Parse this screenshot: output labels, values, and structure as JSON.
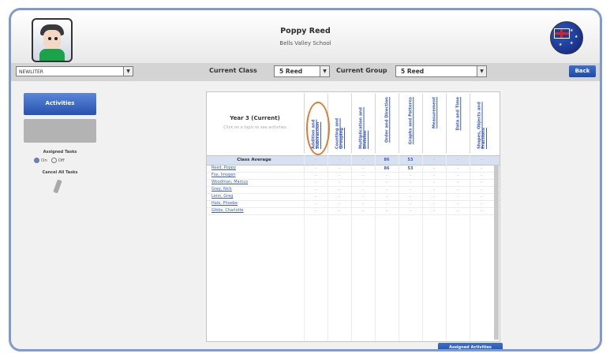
{
  "header": {
    "student_name": "Poppy Reed",
    "school_name": "Bells Valley School"
  },
  "toolbar": {
    "left_select_value": "NEWLITER",
    "current_class_label": "Current Class",
    "current_class_value": "5 Reed",
    "current_group_label": "Current Group",
    "current_group_value": "5 Reed",
    "back_label": "Back"
  },
  "sidebar": {
    "activities_label": "Activities",
    "assigned_tasks_label": "Assigned Tasks",
    "radio_on_label": "On",
    "radio_off_label": "Off",
    "cancel_all_label": "Cancel All Tasks"
  },
  "grid": {
    "year_title": "Year 3 (Current)",
    "year_subtitle": "Click on a topic to see activities",
    "columns": [
      "Addition and Subtraction",
      "Counting and Grouping",
      "Multiplication and Division",
      "Order and Direction",
      "Graphs and Patterns",
      "Measurement",
      "Data and Time",
      "Shapes, Objects and Fractions"
    ],
    "average_label": "Class Average",
    "average_values": [
      "-",
      "-",
      "-",
      "86",
      "53",
      "-",
      "-",
      "-"
    ],
    "students": [
      {
        "name": "Reed, Poppy",
        "values": [
          "-",
          "-",
          "-",
          "86",
          "53",
          "-",
          "-",
          "-"
        ]
      },
      {
        "name": "Fox, Imogen",
        "values": [
          "-",
          "-",
          "-",
          "-",
          "-",
          "-",
          "-",
          "-"
        ]
      },
      {
        "name": "Woodman, Marcus",
        "values": [
          "-",
          "-",
          "-",
          "-",
          "-",
          "-",
          "-",
          "-"
        ]
      },
      {
        "name": "Grey, Nick",
        "values": [
          "-",
          "-",
          "-",
          "-",
          "-",
          "-",
          "-",
          "-"
        ]
      },
      {
        "name": "Lenn, Greg",
        "values": [
          "-",
          "-",
          "-",
          "-",
          "-",
          "-",
          "-",
          "-"
        ]
      },
      {
        "name": "Hale, Phoebe",
        "values": [
          "-",
          "-",
          "-",
          "-",
          "-",
          "-",
          "-",
          "-"
        ]
      },
      {
        "name": "Gibbs, Charlotte",
        "values": [
          "-",
          "-",
          "-",
          "-",
          "-",
          "-",
          "-",
          "-"
        ]
      }
    ]
  },
  "footer": {
    "assigned_activities_label": "Assigned Activities"
  },
  "colors": {
    "frame_border": "#7e9bd1",
    "primary_button": "#2753b0",
    "highlight_ring": "#e07a2e",
    "link": "#3b5cc2"
  }
}
